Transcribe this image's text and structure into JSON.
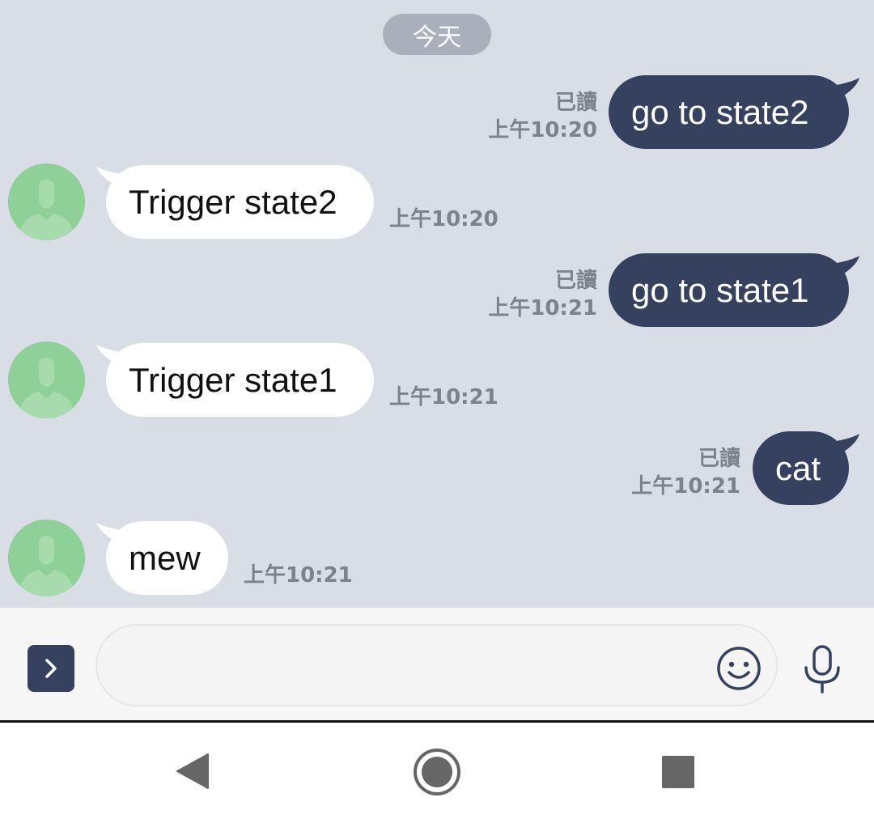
{
  "chat": {
    "date_label": "今天",
    "messages": [
      {
        "direction": "out",
        "text": "go to state2",
        "read": "已讀",
        "time": "上午10:20"
      },
      {
        "direction": "in",
        "text": "Trigger state2",
        "time": "上午10:20"
      },
      {
        "direction": "out",
        "text": "go to state1",
        "read": "已讀",
        "time": "上午10:21"
      },
      {
        "direction": "in",
        "text": "Trigger state1",
        "time": "上午10:21"
      },
      {
        "direction": "out",
        "text": "cat",
        "read": "已讀",
        "time": "上午10:21"
      },
      {
        "direction": "in",
        "text": "mew",
        "time": "上午10:21"
      }
    ]
  },
  "composer": {
    "expand_icon": "chevron-right-icon",
    "emoji_icon": "smiley-icon",
    "mic_icon": "microphone-icon",
    "placeholder": ""
  },
  "navbar": {
    "back_icon": "back-triangle-icon",
    "home_icon": "home-circle-icon",
    "recent_icon": "recent-apps-square-icon"
  },
  "colors": {
    "chat_background": "#d8dde6",
    "outgoing_bubble": "#35415e",
    "incoming_bubble": "#ffffff",
    "avatar": "#8fcf98",
    "meta_text": "#7c828c",
    "date_pill": "#aab0bb"
  }
}
